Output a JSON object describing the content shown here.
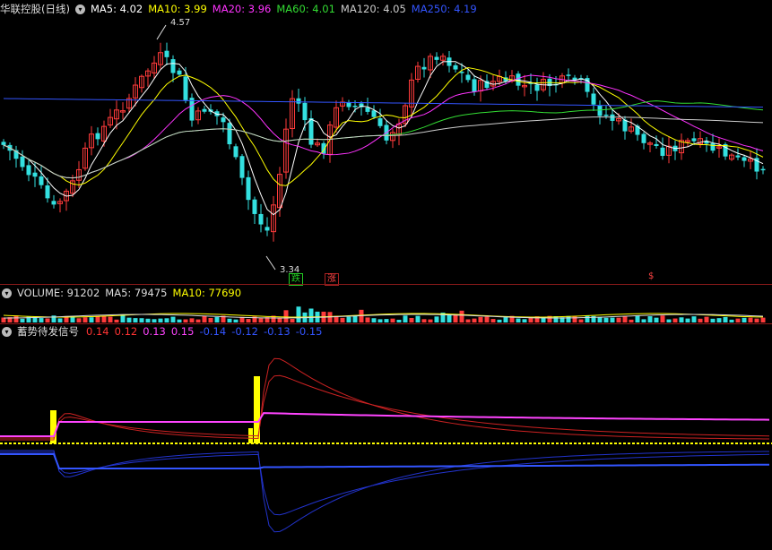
{
  "main": {
    "title": "华联控股(日线)",
    "ma": [
      {
        "label": "MA5: 4.02",
        "color": "#ffffff"
      },
      {
        "label": "MA10: 3.99",
        "color": "#ffff00"
      },
      {
        "label": "MA20: 3.96",
        "color": "#ff33ff"
      },
      {
        "label": "MA60: 4.01",
        "color": "#33dd33"
      },
      {
        "label": "MA120: 4.05",
        "color": "#cccccc"
      },
      {
        "label": "MA250: 4.19",
        "color": "#3355ff"
      }
    ],
    "high_label": "4.57",
    "low_label": "3.34",
    "marks": [
      "跌",
      "涨",
      "$"
    ],
    "price_range": [
      3.2,
      4.65
    ]
  },
  "volume": {
    "labels": [
      {
        "text": "VOLUME: 91202",
        "color": "#dddddd"
      },
      {
        "text": "MA5: 79475",
        "color": "#dddddd"
      },
      {
        "text": "MA10: 77690",
        "color": "#ffff00"
      }
    ]
  },
  "indicator": {
    "title": "蓄势待发信号",
    "values": [
      {
        "text": "0.14",
        "color": "#ff3333"
      },
      {
        "text": "0.12",
        "color": "#ff3333"
      },
      {
        "text": "0.13",
        "color": "#ff44ff"
      },
      {
        "text": "0.15",
        "color": "#ff44ff"
      },
      {
        "text": "-0.14",
        "color": "#3355ff"
      },
      {
        "text": "-0.12",
        "color": "#3355ff"
      },
      {
        "text": "-0.13",
        "color": "#3355ff"
      },
      {
        "text": "-0.15",
        "color": "#3355ff"
      }
    ]
  }
}
